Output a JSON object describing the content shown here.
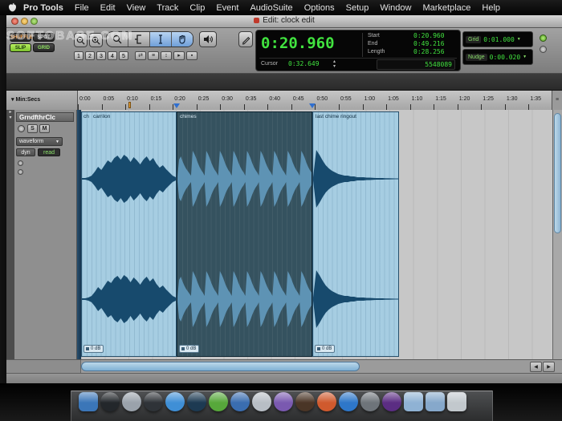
{
  "watermark": {
    "text": "SOFTOBASE.COM"
  },
  "menu_bar": {
    "items": [
      "Pro Tools",
      "File",
      "Edit",
      "View",
      "Track",
      "Clip",
      "Event",
      "AudioSuite",
      "Options",
      "Setup",
      "Window",
      "Marketplace",
      "Help"
    ]
  },
  "window": {
    "title": "Edit: clock edit"
  },
  "edit_modes": {
    "shuffle": "SHUFFLE",
    "spot": "SPOT",
    "slip": "SLIP",
    "grid": "GRID"
  },
  "zoom_presets": [
    "1",
    "2",
    "3",
    "4",
    "5"
  ],
  "mini_buttons": [
    "⇄",
    "≡",
    "↕",
    "▸",
    "▪"
  ],
  "counter": {
    "main": "0:20.960",
    "start_label": "Start",
    "start": "0:20.960",
    "end_label": "End",
    "end": "0:49.216",
    "length_label": "Length",
    "length": "0:28.256",
    "cursor_label": "Cursor",
    "cursor_value": "0:32.649",
    "sub_counter": "5548089"
  },
  "grid_nudge": {
    "grid_label": "Grid",
    "grid_value": "0:01.000",
    "nudge_label": "Nudge",
    "nudge_value": "0:00.020"
  },
  "ruler": {
    "unit_label": "Min:Secs",
    "ticks": [
      "0:00",
      "0:05",
      "0:10",
      "0:15",
      "0:20",
      "0:25",
      "0:30",
      "0:35",
      "0:40",
      "0:45",
      "0:50",
      "0:55",
      "1:00",
      "1:05",
      "1:10",
      "1:15",
      "1:20",
      "1:25",
      "1:30",
      "1:35"
    ]
  },
  "track": {
    "name": "GrndfthrClc",
    "solo": "S",
    "mute": "M",
    "view_selector": "waveform",
    "automation_mode": "dyn",
    "read_mode": "read"
  },
  "clips": {
    "prefix_label": "ch",
    "regions": [
      {
        "label": "carrilon"
      },
      {
        "label": "chimes"
      },
      {
        "label": "last chime ringout"
      }
    ],
    "gain_badge": "0 dB"
  },
  "waveforms": {
    "carrilon": [
      1,
      1,
      2,
      4,
      9,
      15,
      11,
      17,
      23,
      20,
      26,
      29,
      24,
      30,
      27,
      21,
      27,
      23,
      18,
      24,
      28,
      22,
      26,
      19,
      14,
      17,
      12,
      8,
      4,
      2
    ],
    "chimes": [
      3,
      24,
      28,
      22,
      17,
      13,
      10,
      7,
      4,
      35,
      31,
      26,
      20,
      15,
      11,
      8,
      4,
      35,
      31,
      26,
      20,
      15,
      11,
      8,
      4,
      35,
      31,
      26,
      20,
      15,
      11,
      8,
      4,
      35,
      31,
      26,
      20,
      15,
      11,
      8,
      4,
      35,
      31,
      26,
      20,
      15,
      11,
      8,
      4,
      35,
      31,
      26,
      20,
      15,
      11,
      8,
      4,
      35,
      31,
      26,
      20,
      15,
      11,
      8,
      4,
      35,
      31,
      26,
      20,
      15,
      11,
      8,
      4,
      35,
      31,
      26,
      20,
      15,
      11,
      8
    ],
    "ringout": [
      2,
      36,
      30,
      23,
      17,
      13,
      10,
      8,
      6,
      5,
      4,
      4,
      3,
      3,
      2,
      2,
      2,
      1.5,
      1.5,
      1.2,
      1,
      1,
      1,
      0.8,
      0.8,
      0.6,
      0.5,
      0.5
    ]
  },
  "colors": {
    "led_green": "#41e33f",
    "slip_green": "#8de34a",
    "region_blue": "#a6cde2",
    "selection_navy": "#35525f",
    "waveform_navy": "#174a6d",
    "tool_highlight": "#6f9fd8"
  },
  "dock": {
    "icons": [
      {
        "name": "finder-icon",
        "color": "#3b76b8",
        "radius": "6px"
      },
      {
        "name": "dashboard-icon",
        "color": "#23272b",
        "radius": "50%"
      },
      {
        "name": "launchpad-icon",
        "color": "#9aa2ab",
        "radius": "50%"
      },
      {
        "name": "app-icon-dark",
        "color": "#2f3338",
        "radius": "50%"
      },
      {
        "name": "safari-icon",
        "color": "#3f8fd6",
        "radius": "50%"
      },
      {
        "name": "app-icon-navy",
        "color": "#1d3a52",
        "radius": "50%"
      },
      {
        "name": "itunes-icon",
        "color": "#57a83b",
        "radius": "50%"
      },
      {
        "name": "app-icon-blue",
        "color": "#3a6db0",
        "radius": "50%"
      },
      {
        "name": "app-icon-silver",
        "color": "#b8bec5",
        "radius": "50%"
      },
      {
        "name": "app-icon-purple",
        "color": "#7a59b0",
        "radius": "50%"
      },
      {
        "name": "garageband-icon",
        "color": "#4a3526",
        "radius": "50%"
      },
      {
        "name": "app-icon-orange",
        "color": "#d05a2e",
        "radius": "50%"
      },
      {
        "name": "app-icon-azure",
        "color": "#2e77c9",
        "radius": "50%"
      },
      {
        "name": "app-icon-gray",
        "color": "#6e747a",
        "radius": "50%"
      },
      {
        "name": "pro-tools-icon",
        "color": "#5b2d83",
        "radius": "50%"
      },
      {
        "name": "folder-icon",
        "color": "#8fb2d4",
        "radius": "5px"
      },
      {
        "name": "folder-icon",
        "color": "#86a8cb",
        "radius": "5px"
      },
      {
        "name": "trash-icon",
        "color": "#c2c8cd",
        "radius": "5px"
      }
    ]
  }
}
